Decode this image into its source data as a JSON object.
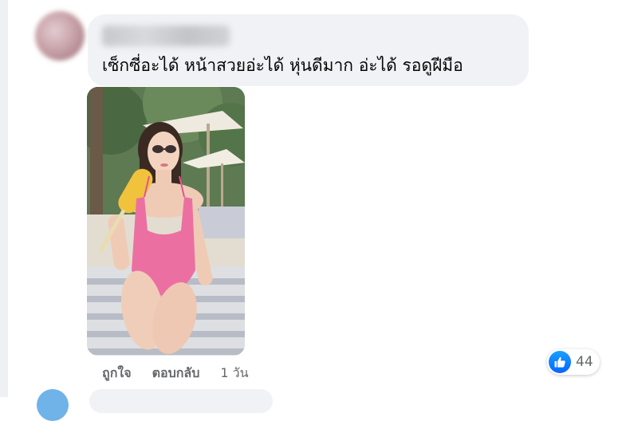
{
  "comment": {
    "author": "",
    "text": "เซ็กซี่อะได้ หน้าสวยอ่ะได้ หุ่นดีมาก อ่ะได้ รอดูฝีมือ",
    "photo": {
      "alt": "",
      "swimsuit_color": "#ec6fa2"
    }
  },
  "actions": {
    "like_label": "ถูกใจ",
    "reply_label": "ตอบกลับ",
    "timestamp": "1 วัน"
  },
  "reactions": {
    "icon": "thumbs-up-icon",
    "count": "44",
    "color": "#0866ff"
  }
}
